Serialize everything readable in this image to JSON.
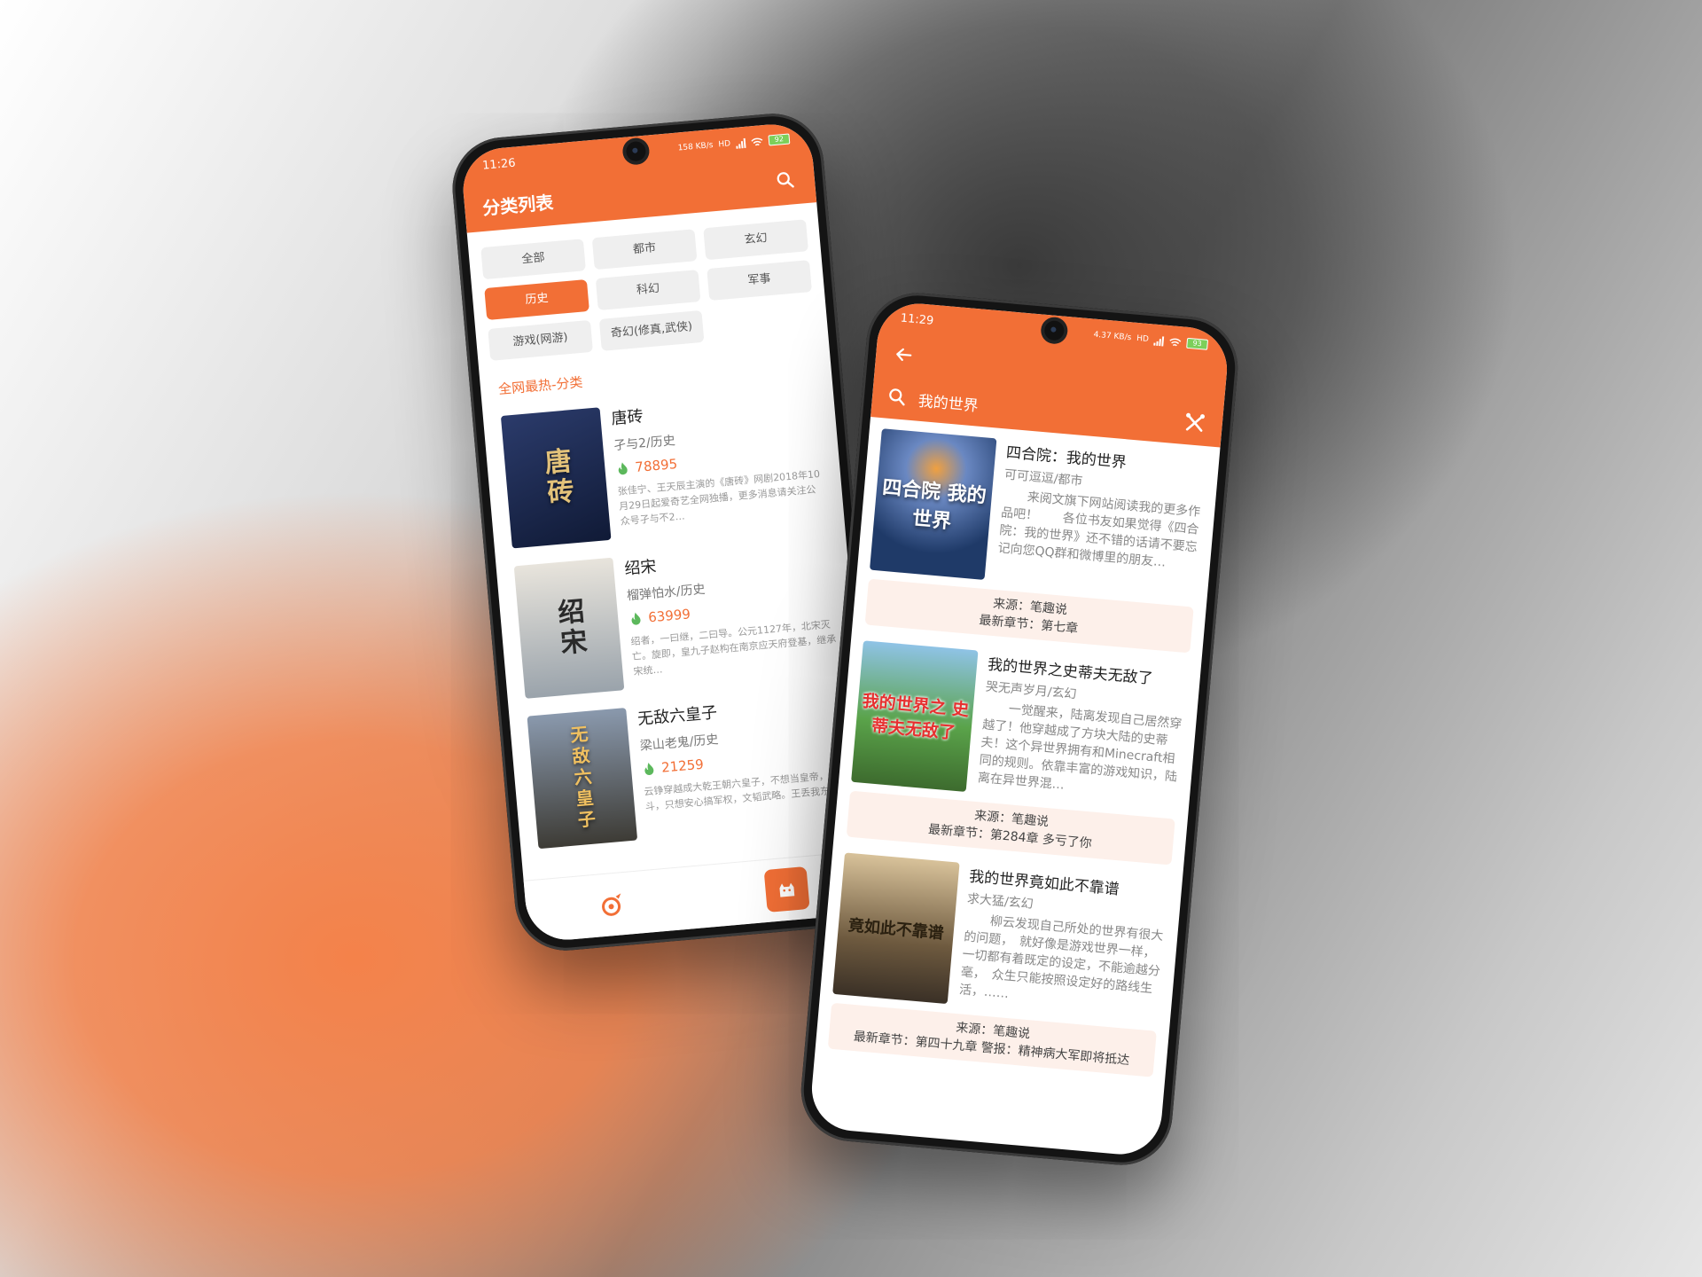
{
  "phone1": {
    "status": {
      "time": "11:26",
      "speed": "158 KB/s",
      "hd": "HD",
      "battery": "92"
    },
    "title": "分类列表",
    "tags": [
      {
        "label": "全部",
        "active": false
      },
      {
        "label": "都市",
        "active": false
      },
      {
        "label": "玄幻",
        "active": false
      },
      {
        "label": "历史",
        "active": true
      },
      {
        "label": "科幻",
        "active": false
      },
      {
        "label": "军事",
        "active": false
      },
      {
        "label": "游戏(网游)",
        "active": false
      },
      {
        "label": "奇幻(修真,武侠)",
        "active": false
      }
    ],
    "section_title": "全网最热-分类",
    "books": [
      {
        "name": "唐砖",
        "meta": "孑与2/历史",
        "heat": "78895",
        "desc": "张佳宁、王天辰主演的《唐砖》网剧2018年10月29日起爱奇艺全网独播，更多消息请关注公众号孑与不2…",
        "cover_text": "唐砖",
        "cover_bg": "#1d2a4d"
      },
      {
        "name": "绍宋",
        "meta": "榴弹怕水/历史",
        "heat": "63999",
        "desc": "绍者，一曰继，二曰导。公元1127年，北宋灭亡。旋即，皇九子赵构在南京应天府登基，继承宋统…",
        "cover_text": "绍宋",
        "cover_bg": "#c7ccd1"
      },
      {
        "name": "无敌六皇子",
        "meta": "梁山老鬼/历史",
        "heat": "21259",
        "desc": "云铮穿越成大乾王朝六皇子，不想当皇帝，不宫斗，只想安心搞军权，文韬武略。王丢我东…",
        "cover_text": "无敌六皇子",
        "cover_bg": "#5b6a7e"
      }
    ]
  },
  "phone2": {
    "status": {
      "time": "11:29",
      "speed": "4.37 KB/s",
      "hd": "HD",
      "battery": "93"
    },
    "search_value": "我的世界",
    "results": [
      {
        "name": "四合院：我的世界",
        "meta": "可可逗逗/都市",
        "desc": "来阅文旗下网站阅读我的更多作品吧！　　各位书友如果觉得《四合院：我的世界》还不错的话请不要忘记向您QQ群和微博里的朋友…",
        "source": "来源：笔趣说",
        "latest": "最新章节：第七章",
        "cover_text": "四合院 我的世界",
        "cover_bg": "#2d4f7e"
      },
      {
        "name": "我的世界之史蒂夫无敌了",
        "meta": "哭无声岁月/玄幻",
        "desc": "一觉醒来，陆离发现自己居然穿越了！他穿越成了方块大陆的史蒂夫！这个异世界拥有和Minecraft相同的规则。依靠丰富的游戏知识，陆离在异世界混…",
        "source": "来源：笔趣说",
        "latest": "最新章节：第284章 多亏了你",
        "cover_text": "我的世界之 史蒂夫无敌了",
        "cover_bg": "#5aa34a"
      },
      {
        "name": "我的世界竟如此不靠谱",
        "meta": "求大猛/玄幻",
        "desc": "柳云发现自己所处的世界有很大的问题，　就好像是游戏世界一样，　一切都有着既定的设定，不能逾越分毫，　众生只能按照设定好的路线生活，……",
        "source": "来源：笔趣说",
        "latest": "最新章节：第四十九章 警报：精神病大军即将抵达",
        "cover_text": "竟如此不靠谱",
        "cover_bg": "#7b6a52"
      }
    ]
  }
}
